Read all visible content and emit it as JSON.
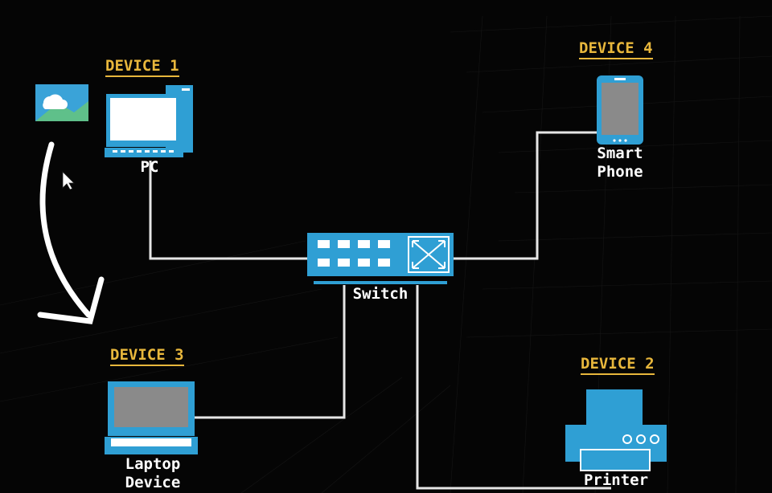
{
  "diagram": {
    "devices": [
      {
        "id": "device-1",
        "tag": "DEVICE 1",
        "label": "PC"
      },
      {
        "id": "device-4",
        "tag": "DEVICE 4",
        "label_line1": "Smart",
        "label_line2": "Phone"
      },
      {
        "id": "device-3",
        "tag": "DEVICE 3",
        "label_line1": "Laptop",
        "label_line2": "Device"
      },
      {
        "id": "device-2",
        "tag": "DEVICE 2",
        "label": "Printer"
      }
    ],
    "switch": {
      "label": "Switch"
    },
    "colors": {
      "background": "#050505",
      "device_blue": "#2f9fd4",
      "device_dark": "#1a7aa6",
      "tag_yellow": "#e8b73c",
      "cable": "#e6e6e6",
      "screen_gray": "#8a8a8a"
    },
    "icons": [
      "image-icon",
      "cursor-icon",
      "curved-arrow-icon"
    ]
  }
}
